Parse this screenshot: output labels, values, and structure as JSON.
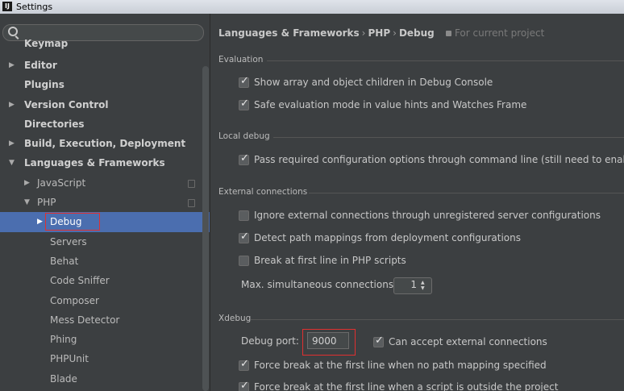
{
  "window": {
    "title": "Settings"
  },
  "sidebar": {
    "search_placeholder": "",
    "items": [
      {
        "label": "Keymap"
      },
      {
        "label": "Editor",
        "arrow": "▶"
      },
      {
        "label": "Plugins"
      },
      {
        "label": "Version Control",
        "arrow": "▶"
      },
      {
        "label": "Directories"
      },
      {
        "label": "Build, Execution, Deployment",
        "arrow": "▶"
      },
      {
        "label": "Languages & Frameworks",
        "arrow": "▼"
      },
      {
        "label": "JavaScript",
        "arrow": "▶"
      },
      {
        "label": "PHP",
        "arrow": "▼"
      },
      {
        "label": "Debug",
        "arrow": "▶"
      },
      {
        "label": "Servers"
      },
      {
        "label": "Behat"
      },
      {
        "label": "Code Sniffer"
      },
      {
        "label": "Composer"
      },
      {
        "label": "Mess Detector"
      },
      {
        "label": "Phing"
      },
      {
        "label": "PHPUnit"
      },
      {
        "label": "Blade"
      }
    ]
  },
  "breadcrumb": {
    "parts": [
      "Languages & Frameworks",
      "PHP",
      "Debug"
    ],
    "separator": "›",
    "scope": "For current project"
  },
  "sections": {
    "evaluation": {
      "title": "Evaluation",
      "options": [
        {
          "label": "Show array and object children in Debug Console",
          "checked": true
        },
        {
          "label": "Safe evaluation mode in value hints and Watches Frame",
          "checked": true
        }
      ]
    },
    "local_debug": {
      "title": "Local debug",
      "options": [
        {
          "label": "Pass required configuration options through command line (still need to enable d",
          "checked": true
        }
      ]
    },
    "external": {
      "title": "External connections",
      "options": [
        {
          "label": "Ignore external connections through unregistered server configurations",
          "checked": false
        },
        {
          "label": "Detect path mappings from deployment configurations",
          "checked": true
        },
        {
          "label": "Break at first line in PHP scripts",
          "checked": false
        }
      ],
      "max_connections_label": "Max. simultaneous connections:",
      "max_connections_value": "1"
    },
    "xdebug": {
      "title": "Xdebug",
      "debug_port_label": "Debug port:",
      "debug_port_value": "9000",
      "accept_external_label": "Can accept external connections",
      "accept_external_checked": true,
      "options": [
        {
          "label": "Force break at the first line when no path mapping specified",
          "checked": true
        },
        {
          "label": "Force break at the first line when a script is outside the project",
          "checked": true
        }
      ]
    }
  },
  "colors": {
    "background": "#3c3f41",
    "selection": "#4b6eaf",
    "highlight_box": "#e03030"
  }
}
